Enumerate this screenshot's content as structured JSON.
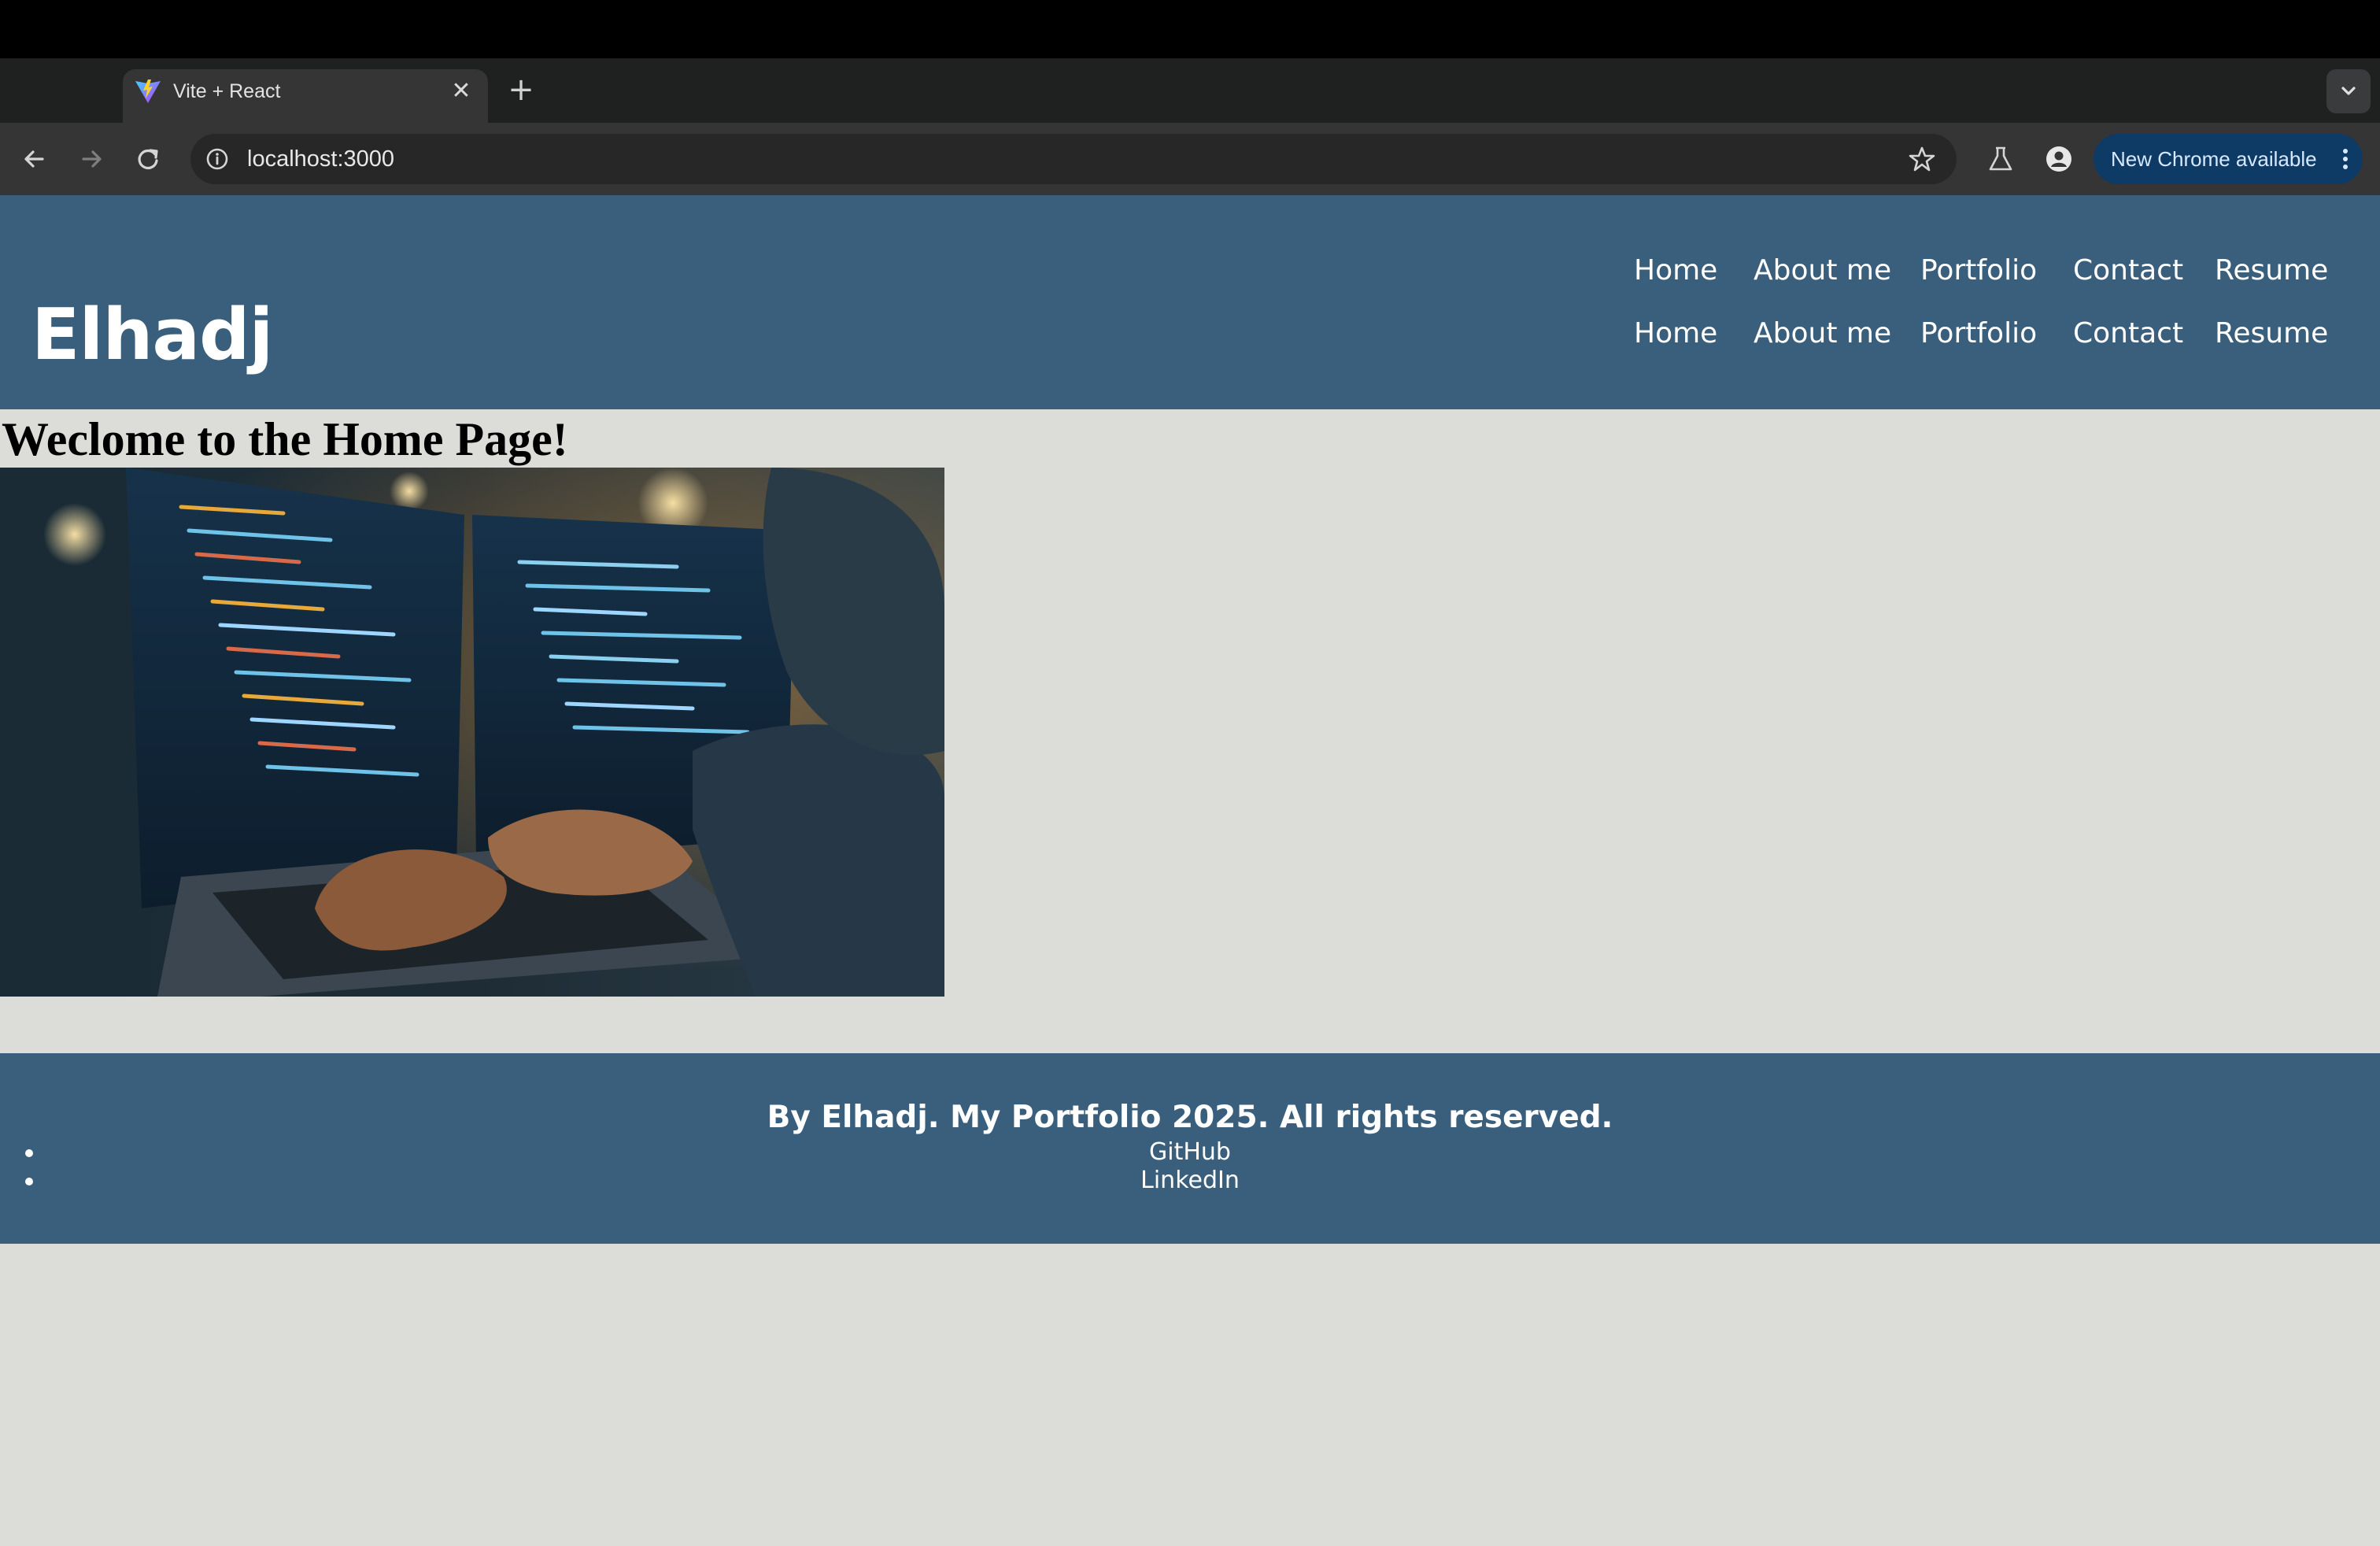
{
  "browser": {
    "tab_title": "Vite + React",
    "tab_favicon": "vite-logo-icon",
    "url": "localhost:3000",
    "update_chip": "New Chrome available",
    "colors": {
      "chrome_dark": "#1f2020",
      "toolbar": "#353535",
      "omnibox": "#272727",
      "update_chip": "#0e3a66"
    }
  },
  "header": {
    "brand": "Elhadj",
    "nav_primary": [
      "Home",
      "About me",
      "Portfolio",
      "Contact",
      "Resume"
    ],
    "nav_secondary": [
      "Home",
      "About me",
      "Portfolio",
      "Contact",
      "Resume"
    ]
  },
  "main": {
    "headline": "Weclome to the Home Page!",
    "hero_image": "laptop-code-photo"
  },
  "footer": {
    "text": "By Elhadj. My Portfolio 2025. All rights reserved.",
    "links": [
      "GitHub",
      "LinkedIn"
    ]
  },
  "colors": {
    "header_bg": "#3a5f7d",
    "page_bg": "#dcddd8"
  }
}
